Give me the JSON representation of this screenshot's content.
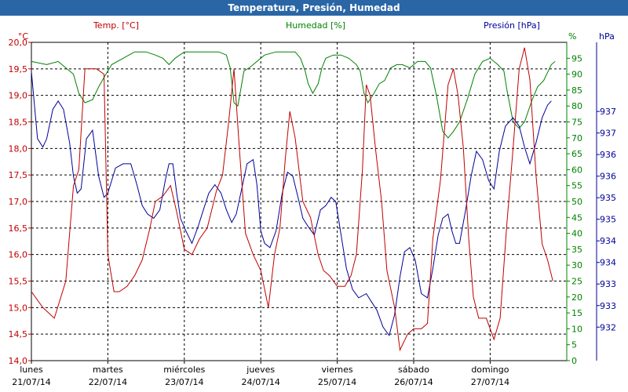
{
  "window": {
    "title": "Temperatura, Presión, Humedad"
  },
  "chart_data": {
    "type": "line",
    "title": "Temperatura, Presión, Humedad",
    "grid": true,
    "x_axis": {
      "range": [
        "21/07/14 00:00",
        "28/07/14 00:00"
      ],
      "tick_labels": [
        {
          "day": "lunes",
          "date": "21/07/14"
        },
        {
          "day": "martes",
          "date": "22/07/14"
        },
        {
          "day": "miércoles",
          "date": "23/07/14"
        },
        {
          "day": "jueves",
          "date": "24/07/14"
        },
        {
          "day": "viernes",
          "date": "25/07/14"
        },
        {
          "day": "sábado",
          "date": "26/07/14"
        },
        {
          "day": "domingo",
          "date": "27/07/14"
        }
      ]
    },
    "axes": {
      "temperature": {
        "label": "Temp. [°C]",
        "unit": "°C",
        "ylim": [
          14.0,
          20.0
        ],
        "ticks": [
          "20,0",
          "19,5",
          "19,0",
          "18,5",
          "18,0",
          "17,5",
          "17,0",
          "16,5",
          "16,0",
          "15,5",
          "15,0",
          "14,5",
          "14,0"
        ],
        "color": "#c00000"
      },
      "humidity": {
        "label": "Humedad [%]",
        "unit": "%",
        "ylim": [
          0,
          100
        ],
        "ticks": [
          "95",
          "90",
          "85",
          "80",
          "75",
          "70",
          "65",
          "60",
          "55",
          "50",
          "45",
          "40",
          "35",
          "30",
          "25",
          "20",
          "15",
          "10",
          "5",
          "0"
        ],
        "color": "#008000"
      },
      "pressure": {
        "label": "Presión [hPa]",
        "unit": "hPa",
        "ylim": [
          931.2,
          938.8
        ],
        "ticks": [
          "937",
          "937",
          "936",
          "936",
          "935",
          "935",
          "934",
          "934",
          "933",
          "933",
          "932"
        ],
        "color": "#000099"
      }
    },
    "series": [
      {
        "name": "Temp. [°C]",
        "axis": "temperature",
        "color": "#c00000",
        "points": [
          [
            0.0,
            15.3
          ],
          [
            0.15,
            15.0
          ],
          [
            0.3,
            14.8
          ],
          [
            0.45,
            15.5
          ],
          [
            0.55,
            17.3
          ],
          [
            0.62,
            17.6
          ],
          [
            0.7,
            19.5
          ],
          [
            0.85,
            19.5
          ],
          [
            0.95,
            19.4
          ],
          [
            1.0,
            16.0
          ],
          [
            1.08,
            15.3
          ],
          [
            1.15,
            15.3
          ],
          [
            1.25,
            15.4
          ],
          [
            1.35,
            15.6
          ],
          [
            1.45,
            15.9
          ],
          [
            1.55,
            16.5
          ],
          [
            1.62,
            17.0
          ],
          [
            1.72,
            17.1
          ],
          [
            1.82,
            17.3
          ],
          [
            1.9,
            16.8
          ],
          [
            2.0,
            16.1
          ],
          [
            2.1,
            16.0
          ],
          [
            2.2,
            16.3
          ],
          [
            2.3,
            16.5
          ],
          [
            2.42,
            17.2
          ],
          [
            2.5,
            17.5
          ],
          [
            2.58,
            18.5
          ],
          [
            2.65,
            19.5
          ],
          [
            2.72,
            18.0
          ],
          [
            2.8,
            16.4
          ],
          [
            2.9,
            16.0
          ],
          [
            3.0,
            15.7
          ],
          [
            3.1,
            15.0
          ],
          [
            3.18,
            16.0
          ],
          [
            3.25,
            16.5
          ],
          [
            3.32,
            17.8
          ],
          [
            3.38,
            18.7
          ],
          [
            3.45,
            18.2
          ],
          [
            3.55,
            17.0
          ],
          [
            3.65,
            16.7
          ],
          [
            3.75,
            16.0
          ],
          [
            3.82,
            15.7
          ],
          [
            3.9,
            15.6
          ],
          [
            4.0,
            15.4
          ],
          [
            4.1,
            15.4
          ],
          [
            4.18,
            15.6
          ],
          [
            4.25,
            16.0
          ],
          [
            4.33,
            17.6
          ],
          [
            4.38,
            19.2
          ],
          [
            4.43,
            19.0
          ],
          [
            4.5,
            18.0
          ],
          [
            4.58,
            17.0
          ],
          [
            4.65,
            15.7
          ],
          [
            4.75,
            15.0
          ],
          [
            4.82,
            14.2
          ],
          [
            4.92,
            14.5
          ],
          [
            5.0,
            14.6
          ],
          [
            5.1,
            14.6
          ],
          [
            5.18,
            14.7
          ],
          [
            5.25,
            16.3
          ],
          [
            5.35,
            17.4
          ],
          [
            5.45,
            19.2
          ],
          [
            5.52,
            19.5
          ],
          [
            5.58,
            19.0
          ],
          [
            5.65,
            18.0
          ],
          [
            5.72,
            16.3
          ],
          [
            5.78,
            15.2
          ],
          [
            5.85,
            14.8
          ],
          [
            5.95,
            14.8
          ],
          [
            6.05,
            14.4
          ],
          [
            6.13,
            14.8
          ],
          [
            6.22,
            16.6
          ],
          [
            6.3,
            18.0
          ],
          [
            6.38,
            19.5
          ],
          [
            6.45,
            19.9
          ],
          [
            6.52,
            19.3
          ],
          [
            6.6,
            17.5
          ],
          [
            6.68,
            16.2
          ],
          [
            6.75,
            15.9
          ],
          [
            6.82,
            15.5
          ]
        ]
      },
      {
        "name": "Humedad [%]",
        "axis": "humidity",
        "color": "#008000",
        "points": [
          [
            0.0,
            94
          ],
          [
            0.2,
            93
          ],
          [
            0.35,
            94
          ],
          [
            0.45,
            92
          ],
          [
            0.55,
            90
          ],
          [
            0.62,
            84
          ],
          [
            0.7,
            81
          ],
          [
            0.8,
            82
          ],
          [
            0.88,
            86
          ],
          [
            0.95,
            89
          ],
          [
            1.05,
            93
          ],
          [
            1.2,
            95
          ],
          [
            1.35,
            97
          ],
          [
            1.5,
            97
          ],
          [
            1.62,
            96
          ],
          [
            1.72,
            95
          ],
          [
            1.8,
            93
          ],
          [
            1.88,
            95
          ],
          [
            2.0,
            97
          ],
          [
            2.15,
            97
          ],
          [
            2.3,
            97
          ],
          [
            2.45,
            97
          ],
          [
            2.55,
            96
          ],
          [
            2.6,
            92
          ],
          [
            2.65,
            81
          ],
          [
            2.7,
            80
          ],
          [
            2.78,
            91
          ],
          [
            2.85,
            92
          ],
          [
            2.95,
            94
          ],
          [
            3.05,
            96
          ],
          [
            3.2,
            97
          ],
          [
            3.35,
            97
          ],
          [
            3.45,
            97
          ],
          [
            3.52,
            95
          ],
          [
            3.58,
            91
          ],
          [
            3.62,
            87
          ],
          [
            3.68,
            84
          ],
          [
            3.75,
            87
          ],
          [
            3.8,
            92
          ],
          [
            3.85,
            95
          ],
          [
            3.95,
            96
          ],
          [
            4.05,
            96
          ],
          [
            4.15,
            95
          ],
          [
            4.25,
            93
          ],
          [
            4.3,
            91
          ],
          [
            4.35,
            84
          ],
          [
            4.4,
            81
          ],
          [
            4.48,
            84
          ],
          [
            4.55,
            87
          ],
          [
            4.62,
            88
          ],
          [
            4.7,
            92
          ],
          [
            4.78,
            93
          ],
          [
            4.85,
            93
          ],
          [
            4.95,
            92
          ],
          [
            5.05,
            94
          ],
          [
            5.15,
            94
          ],
          [
            5.22,
            92
          ],
          [
            5.3,
            83
          ],
          [
            5.38,
            72
          ],
          [
            5.45,
            70
          ],
          [
            5.52,
            72
          ],
          [
            5.6,
            75
          ],
          [
            5.7,
            82
          ],
          [
            5.8,
            90
          ],
          [
            5.9,
            94
          ],
          [
            6.0,
            95
          ],
          [
            6.1,
            93
          ],
          [
            6.18,
            91
          ],
          [
            6.22,
            85
          ],
          [
            6.3,
            75
          ],
          [
            6.38,
            73
          ],
          [
            6.45,
            75
          ],
          [
            6.55,
            82
          ],
          [
            6.62,
            86
          ],
          [
            6.7,
            88
          ],
          [
            6.8,
            93
          ],
          [
            6.85,
            94
          ]
        ]
      },
      {
        "name": "Presión [hPa]",
        "axis": "pressure",
        "color": "#000099",
        "points": [
          [
            0.0,
            938.1
          ],
          [
            0.08,
            936.5
          ],
          [
            0.15,
            936.3
          ],
          [
            0.2,
            936.5
          ],
          [
            0.28,
            937.2
          ],
          [
            0.35,
            937.4
          ],
          [
            0.42,
            937.2
          ],
          [
            0.5,
            936.4
          ],
          [
            0.55,
            935.6
          ],
          [
            0.6,
            935.2
          ],
          [
            0.65,
            935.3
          ],
          [
            0.72,
            936.5
          ],
          [
            0.8,
            936.7
          ],
          [
            0.88,
            935.6
          ],
          [
            0.95,
            935.1
          ],
          [
            1.0,
            935.2
          ],
          [
            1.1,
            935.8
          ],
          [
            1.2,
            935.9
          ],
          [
            1.3,
            935.9
          ],
          [
            1.38,
            935.4
          ],
          [
            1.45,
            934.9
          ],
          [
            1.52,
            934.7
          ],
          [
            1.6,
            934.6
          ],
          [
            1.68,
            934.8
          ],
          [
            1.75,
            935.5
          ],
          [
            1.8,
            935.9
          ],
          [
            1.85,
            935.9
          ],
          [
            1.9,
            935.2
          ],
          [
            1.95,
            934.6
          ],
          [
            2.02,
            934.3
          ],
          [
            2.1,
            934.0
          ],
          [
            2.18,
            934.4
          ],
          [
            2.25,
            934.8
          ],
          [
            2.32,
            935.2
          ],
          [
            2.4,
            935.4
          ],
          [
            2.48,
            935.2
          ],
          [
            2.55,
            934.8
          ],
          [
            2.62,
            934.5
          ],
          [
            2.68,
            934.7
          ],
          [
            2.75,
            935.3
          ],
          [
            2.82,
            935.9
          ],
          [
            2.9,
            936.0
          ],
          [
            2.95,
            935.4
          ],
          [
            3.0,
            934.3
          ],
          [
            3.05,
            934.0
          ],
          [
            3.12,
            933.9
          ],
          [
            3.2,
            934.3
          ],
          [
            3.28,
            935.2
          ],
          [
            3.35,
            935.7
          ],
          [
            3.42,
            935.6
          ],
          [
            3.5,
            935.0
          ],
          [
            3.55,
            934.6
          ],
          [
            3.62,
            934.4
          ],
          [
            3.7,
            934.2
          ],
          [
            3.78,
            934.8
          ],
          [
            3.85,
            934.9
          ],
          [
            3.92,
            935.1
          ],
          [
            3.98,
            935.0
          ],
          [
            4.05,
            934.2
          ],
          [
            4.12,
            933.4
          ],
          [
            4.2,
            932.9
          ],
          [
            4.28,
            932.7
          ],
          [
            4.38,
            932.8
          ],
          [
            4.45,
            932.6
          ],
          [
            4.52,
            932.4
          ],
          [
            4.6,
            932.0
          ],
          [
            4.68,
            931.8
          ],
          [
            4.75,
            932.3
          ],
          [
            4.82,
            933.2
          ],
          [
            4.88,
            933.8
          ],
          [
            4.95,
            933.9
          ],
          [
            5.02,
            933.6
          ],
          [
            5.1,
            932.8
          ],
          [
            5.18,
            932.7
          ],
          [
            5.25,
            933.4
          ],
          [
            5.32,
            934.2
          ],
          [
            5.38,
            934.6
          ],
          [
            5.45,
            934.7
          ],
          [
            5.5,
            934.3
          ],
          [
            5.55,
            934.0
          ],
          [
            5.6,
            934.0
          ],
          [
            5.68,
            934.8
          ],
          [
            5.75,
            935.6
          ],
          [
            5.82,
            936.2
          ],
          [
            5.9,
            936.0
          ],
          [
            5.98,
            935.5
          ],
          [
            6.05,
            935.3
          ],
          [
            6.12,
            936.2
          ],
          [
            6.2,
            936.8
          ],
          [
            6.3,
            937.0
          ],
          [
            6.38,
            936.8
          ],
          [
            6.45,
            936.3
          ],
          [
            6.52,
            935.9
          ],
          [
            6.6,
            936.4
          ],
          [
            6.68,
            937.0
          ],
          [
            6.75,
            937.3
          ],
          [
            6.8,
            937.4
          ]
        ]
      }
    ]
  }
}
